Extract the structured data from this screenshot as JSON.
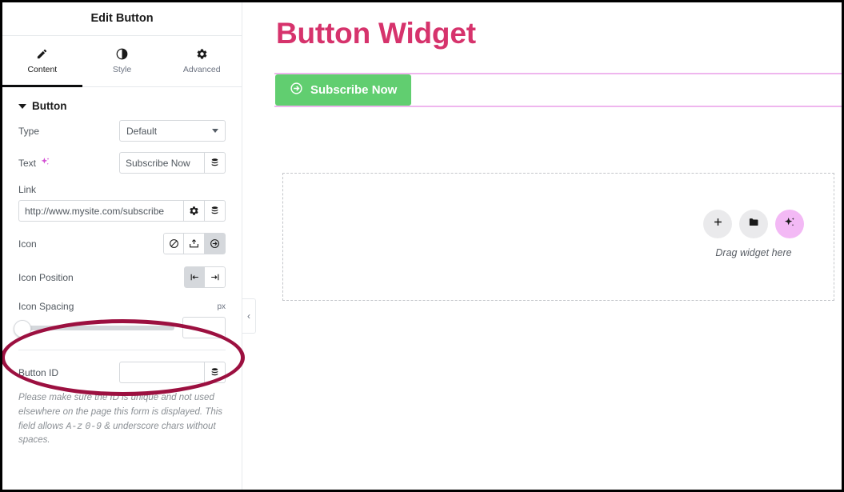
{
  "panel": {
    "title": "Edit Button",
    "tabs": [
      {
        "label": "Content",
        "icon": "pencil-icon",
        "active": true
      },
      {
        "label": "Style",
        "icon": "contrast-icon",
        "active": false
      },
      {
        "label": "Advanced",
        "icon": "gear-icon",
        "active": false
      }
    ],
    "section": {
      "title": "Button",
      "type": {
        "label": "Type",
        "value": "Default"
      },
      "text": {
        "label": "Text",
        "value": "Subscribe Now",
        "ai_icon": "ai-sparkle-icon",
        "dynamic_icon": "dynamic-tags-icon"
      },
      "link": {
        "label": "Link",
        "value": "http://www.mysite.com/subscribe",
        "settings_icon": "gear-icon",
        "dynamic_icon": "dynamic-tags-icon"
      },
      "icon": {
        "label": "Icon",
        "options": [
          {
            "name": "none-icon",
            "selected": false
          },
          {
            "name": "upload-icon",
            "selected": false
          },
          {
            "name": "arrow-circle-right-icon",
            "selected": true
          }
        ]
      },
      "icon_position": {
        "label": "Icon Position",
        "options": [
          {
            "name": "align-left-icon",
            "selected": true
          },
          {
            "name": "align-right-icon",
            "selected": false
          }
        ]
      },
      "icon_spacing": {
        "label": "Icon Spacing",
        "unit": "px",
        "value": "",
        "slider_percent": 0
      },
      "button_id": {
        "label": "Button ID",
        "value": "",
        "dynamic_icon": "dynamic-tags-icon"
      },
      "help_text_1": "Please make sure the ID is unique and not used elsewhere on the page this form is displayed. This field allows ",
      "help_mono_1": "A-z",
      "help_text_2": " ",
      "help_mono_2": "0-9",
      "help_text_3": " & underscore chars without spaces."
    },
    "collapse_icon": "chevron-left-icon"
  },
  "canvas": {
    "page_title": "Button Widget",
    "button": {
      "label": "Subscribe Now",
      "icon": "arrow-circle-right-icon",
      "bg_color": "#61ce70",
      "text_color": "#ffffff"
    },
    "dropzone": {
      "label": "Drag widget here",
      "buttons": [
        {
          "name": "add-element-button",
          "icon": "plus-icon"
        },
        {
          "name": "open-library-button",
          "icon": "folder-icon"
        },
        {
          "name": "ai-generate-button",
          "icon": "ai-sparkle-icon"
        }
      ]
    }
  },
  "annotation": {
    "shape": "ellipse",
    "color": "#9c1040",
    "target": "Icon Spacing"
  },
  "colors": {
    "title_pink": "#d6336c",
    "selection_outline": "#efb6ee",
    "button_green": "#61ce70",
    "annotation": "#9c1040"
  }
}
